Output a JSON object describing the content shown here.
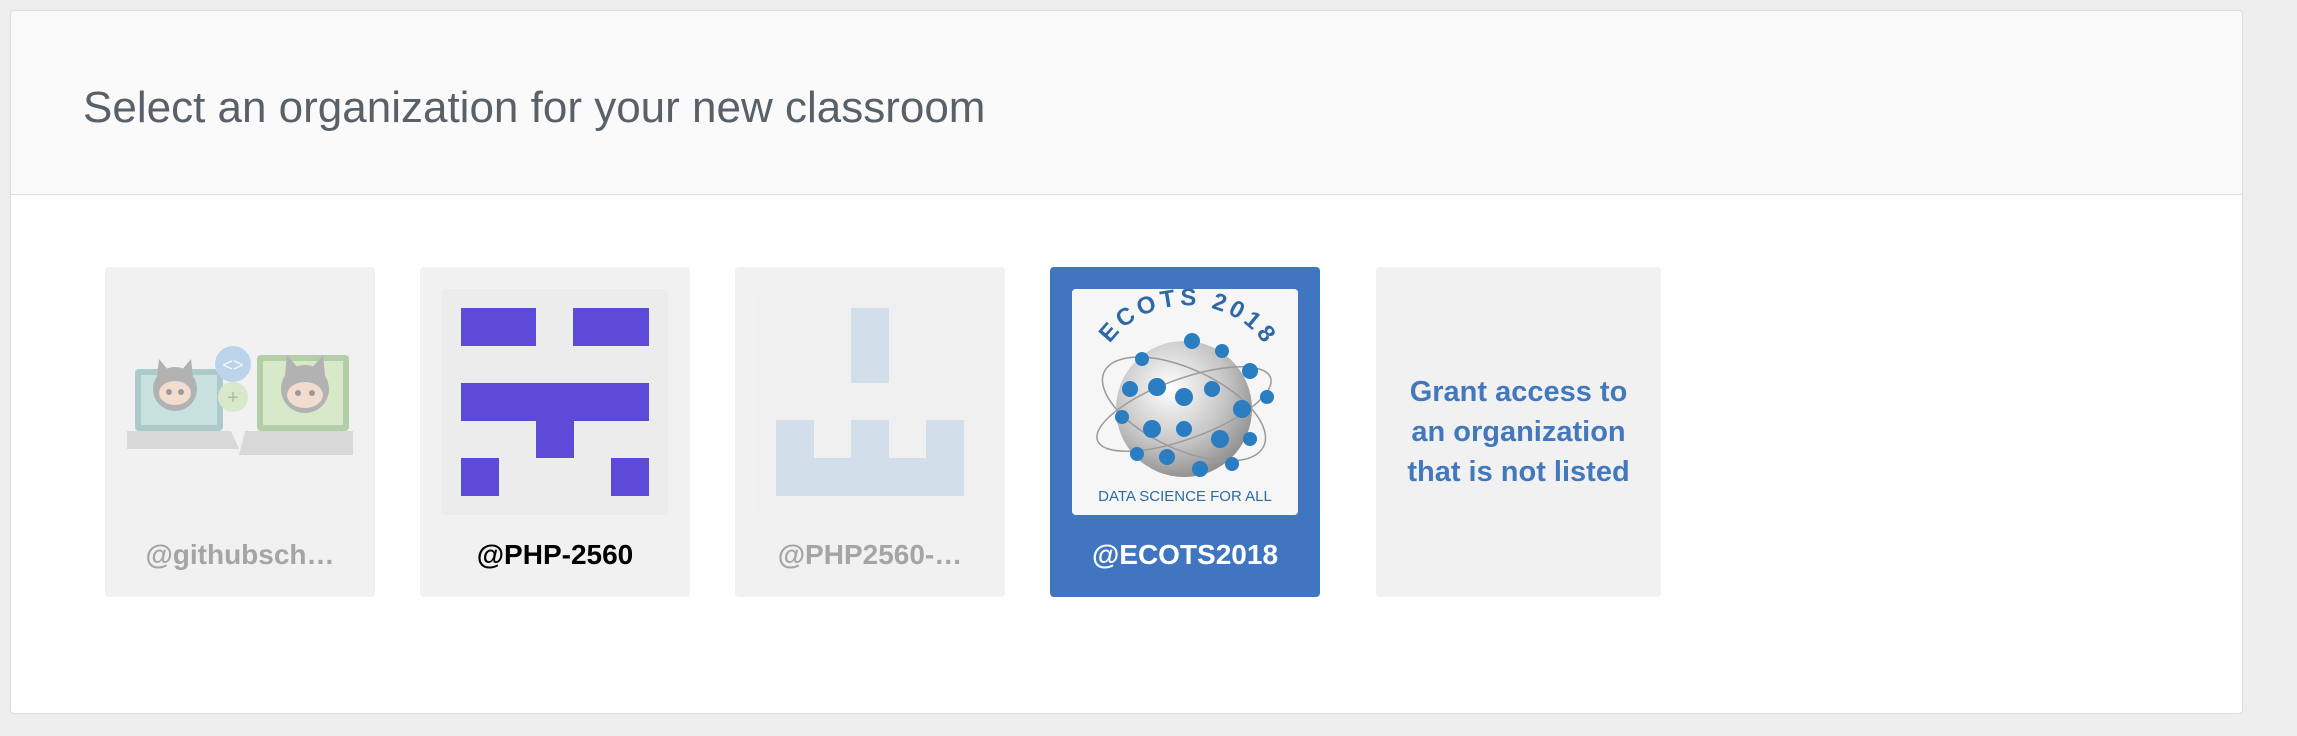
{
  "page": {
    "title": "Select an organization for your new classroom"
  },
  "organizations": [
    {
      "name": "@githubsch…",
      "state": "disabled",
      "avatar": "github-classroom-octocats"
    },
    {
      "name": "@PHP-2560",
      "state": "enabled",
      "avatar": "purple-identicon"
    },
    {
      "name": "@PHP2560-…",
      "state": "disabled",
      "avatar": "light-blue-identicon"
    },
    {
      "name": "@ECOTS2018",
      "state": "selected",
      "avatar": "ecots-globe-logo",
      "logo_text": {
        "top": "ECOTS 2018",
        "bottom": "DATA SCIENCE FOR ALL"
      }
    }
  ],
  "grant_access": {
    "label": "Grant access to an organization that is not listed"
  },
  "colors": {
    "selected_card": "#3f76bf",
    "card_bg": "#f1f1f1",
    "link": "#4378bd",
    "identicon_purple": "#5b4bd8",
    "identicon_blue": "#c9d8ea"
  }
}
